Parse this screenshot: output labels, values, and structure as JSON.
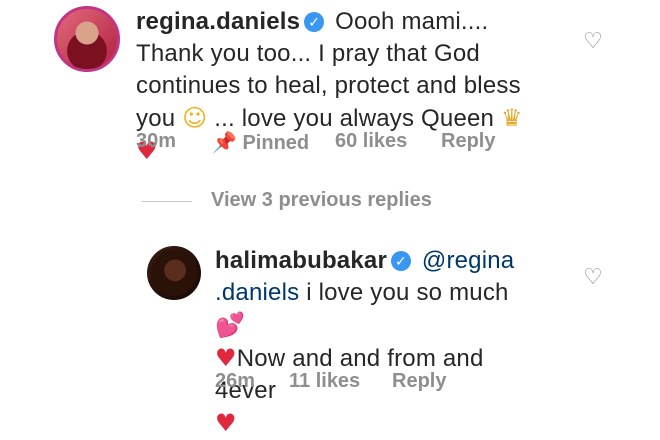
{
  "comments": [
    {
      "username": "regina.daniels",
      "text_part1": "Oooh mami.... Thank you too... I pray that God continues to heal, protect and bless you",
      "text_part2": "... love you always Queen",
      "time": "30m",
      "pinned_label": "Pinned",
      "likes": "60 likes",
      "reply_label": "Reply"
    },
    {
      "username": "halimabubakar",
      "mention": "@regina .daniels",
      "text_part1": "i love you so much",
      "text_part2": "Now and and from and 4ever",
      "time": "26m",
      "likes": "11 likes",
      "reply_label": "Reply"
    }
  ],
  "view_replies_label": "View 3 previous replies",
  "colors": {
    "text": "#262626",
    "meta": "#8e8e8e",
    "verified": "#3897f0",
    "mention": "#00376b",
    "heart": "#e0283e"
  },
  "icons": {
    "verified": "verified-badge-icon",
    "like": "heart-outline-icon",
    "pin": "pin-icon",
    "hug_emoji": "hugging-face-emoji",
    "crown_emoji": "crown-emoji",
    "red_heart_emoji": "red-heart-emoji",
    "two_hearts_emoji": "two-hearts-emoji"
  }
}
